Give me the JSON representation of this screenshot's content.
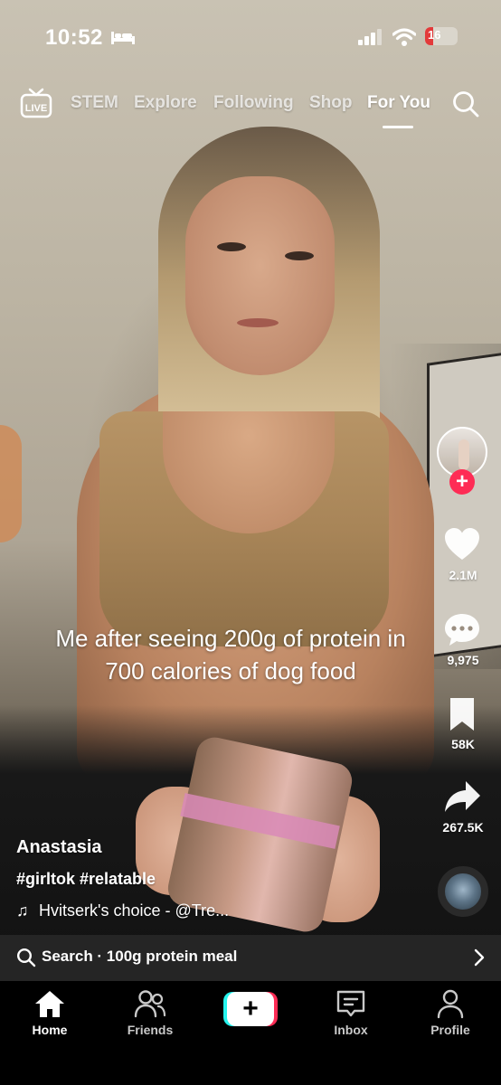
{
  "status_bar": {
    "time": "10:52",
    "battery": "16"
  },
  "top_nav": {
    "live_label": "LIVE",
    "tabs": [
      {
        "label": "STEM",
        "active": false
      },
      {
        "label": "Explore",
        "active": false
      },
      {
        "label": "Following",
        "active": false
      },
      {
        "label": "Shop",
        "active": false
      },
      {
        "label": "For You",
        "active": true
      }
    ]
  },
  "video": {
    "caption": "Me after seeing 200g of protein in 700 calories of dog food",
    "author": "Anastasia",
    "hashtags": "#girltok #relatable",
    "music": "Hvitserk's choice - @Tre..."
  },
  "actions": {
    "likes": "2.1M",
    "comments": "9,975",
    "saves": "58K",
    "shares": "267.5K"
  },
  "search_suggestion": {
    "text": "Search · 100g protein meal"
  },
  "bottom_tabs": [
    {
      "label": "Home",
      "active": true
    },
    {
      "label": "Friends",
      "active": false
    },
    {
      "label": "Inbox",
      "active": false
    },
    {
      "label": "Profile",
      "active": false
    }
  ],
  "colors": {
    "accent_red": "#fe2c55",
    "accent_cyan": "#25f4ee",
    "battery_low": "#e33a3a"
  }
}
